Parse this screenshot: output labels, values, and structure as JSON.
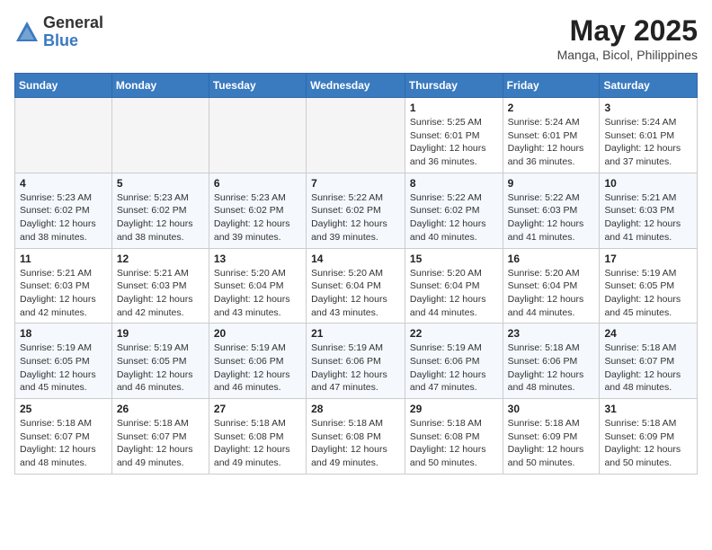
{
  "logo": {
    "general": "General",
    "blue": "Blue"
  },
  "title": "May 2025",
  "location": "Manga, Bicol, Philippines",
  "days_header": [
    "Sunday",
    "Monday",
    "Tuesday",
    "Wednesday",
    "Thursday",
    "Friday",
    "Saturday"
  ],
  "weeks": [
    [
      {
        "day": "",
        "info": ""
      },
      {
        "day": "",
        "info": ""
      },
      {
        "day": "",
        "info": ""
      },
      {
        "day": "",
        "info": ""
      },
      {
        "day": "1",
        "info": "Sunrise: 5:25 AM\nSunset: 6:01 PM\nDaylight: 12 hours\nand 36 minutes."
      },
      {
        "day": "2",
        "info": "Sunrise: 5:24 AM\nSunset: 6:01 PM\nDaylight: 12 hours\nand 36 minutes."
      },
      {
        "day": "3",
        "info": "Sunrise: 5:24 AM\nSunset: 6:01 PM\nDaylight: 12 hours\nand 37 minutes."
      }
    ],
    [
      {
        "day": "4",
        "info": "Sunrise: 5:23 AM\nSunset: 6:02 PM\nDaylight: 12 hours\nand 38 minutes."
      },
      {
        "day": "5",
        "info": "Sunrise: 5:23 AM\nSunset: 6:02 PM\nDaylight: 12 hours\nand 38 minutes."
      },
      {
        "day": "6",
        "info": "Sunrise: 5:23 AM\nSunset: 6:02 PM\nDaylight: 12 hours\nand 39 minutes."
      },
      {
        "day": "7",
        "info": "Sunrise: 5:22 AM\nSunset: 6:02 PM\nDaylight: 12 hours\nand 39 minutes."
      },
      {
        "day": "8",
        "info": "Sunrise: 5:22 AM\nSunset: 6:02 PM\nDaylight: 12 hours\nand 40 minutes."
      },
      {
        "day": "9",
        "info": "Sunrise: 5:22 AM\nSunset: 6:03 PM\nDaylight: 12 hours\nand 41 minutes."
      },
      {
        "day": "10",
        "info": "Sunrise: 5:21 AM\nSunset: 6:03 PM\nDaylight: 12 hours\nand 41 minutes."
      }
    ],
    [
      {
        "day": "11",
        "info": "Sunrise: 5:21 AM\nSunset: 6:03 PM\nDaylight: 12 hours\nand 42 minutes."
      },
      {
        "day": "12",
        "info": "Sunrise: 5:21 AM\nSunset: 6:03 PM\nDaylight: 12 hours\nand 42 minutes."
      },
      {
        "day": "13",
        "info": "Sunrise: 5:20 AM\nSunset: 6:04 PM\nDaylight: 12 hours\nand 43 minutes."
      },
      {
        "day": "14",
        "info": "Sunrise: 5:20 AM\nSunset: 6:04 PM\nDaylight: 12 hours\nand 43 minutes."
      },
      {
        "day": "15",
        "info": "Sunrise: 5:20 AM\nSunset: 6:04 PM\nDaylight: 12 hours\nand 44 minutes."
      },
      {
        "day": "16",
        "info": "Sunrise: 5:20 AM\nSunset: 6:04 PM\nDaylight: 12 hours\nand 44 minutes."
      },
      {
        "day": "17",
        "info": "Sunrise: 5:19 AM\nSunset: 6:05 PM\nDaylight: 12 hours\nand 45 minutes."
      }
    ],
    [
      {
        "day": "18",
        "info": "Sunrise: 5:19 AM\nSunset: 6:05 PM\nDaylight: 12 hours\nand 45 minutes."
      },
      {
        "day": "19",
        "info": "Sunrise: 5:19 AM\nSunset: 6:05 PM\nDaylight: 12 hours\nand 46 minutes."
      },
      {
        "day": "20",
        "info": "Sunrise: 5:19 AM\nSunset: 6:06 PM\nDaylight: 12 hours\nand 46 minutes."
      },
      {
        "day": "21",
        "info": "Sunrise: 5:19 AM\nSunset: 6:06 PM\nDaylight: 12 hours\nand 47 minutes."
      },
      {
        "day": "22",
        "info": "Sunrise: 5:19 AM\nSunset: 6:06 PM\nDaylight: 12 hours\nand 47 minutes."
      },
      {
        "day": "23",
        "info": "Sunrise: 5:18 AM\nSunset: 6:06 PM\nDaylight: 12 hours\nand 48 minutes."
      },
      {
        "day": "24",
        "info": "Sunrise: 5:18 AM\nSunset: 6:07 PM\nDaylight: 12 hours\nand 48 minutes."
      }
    ],
    [
      {
        "day": "25",
        "info": "Sunrise: 5:18 AM\nSunset: 6:07 PM\nDaylight: 12 hours\nand 48 minutes."
      },
      {
        "day": "26",
        "info": "Sunrise: 5:18 AM\nSunset: 6:07 PM\nDaylight: 12 hours\nand 49 minutes."
      },
      {
        "day": "27",
        "info": "Sunrise: 5:18 AM\nSunset: 6:08 PM\nDaylight: 12 hours\nand 49 minutes."
      },
      {
        "day": "28",
        "info": "Sunrise: 5:18 AM\nSunset: 6:08 PM\nDaylight: 12 hours\nand 49 minutes."
      },
      {
        "day": "29",
        "info": "Sunrise: 5:18 AM\nSunset: 6:08 PM\nDaylight: 12 hours\nand 50 minutes."
      },
      {
        "day": "30",
        "info": "Sunrise: 5:18 AM\nSunset: 6:09 PM\nDaylight: 12 hours\nand 50 minutes."
      },
      {
        "day": "31",
        "info": "Sunrise: 5:18 AM\nSunset: 6:09 PM\nDaylight: 12 hours\nand 50 minutes."
      }
    ]
  ]
}
